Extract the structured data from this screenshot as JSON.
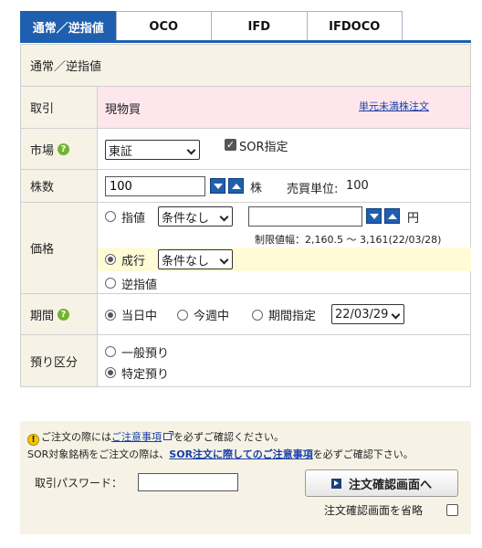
{
  "tabs": [
    {
      "label": "通常／逆指値",
      "active": true
    },
    {
      "label": "OCO",
      "active": false
    },
    {
      "label": "IFD",
      "active": false
    },
    {
      "label": "IFDOCO",
      "active": false
    }
  ],
  "section_title": "通常／逆指値",
  "trade": {
    "label": "取引",
    "value": "現物買",
    "odd_lot_link": "単元未満株注文"
  },
  "market": {
    "label": "市場",
    "help_icon": "question-circle-icon",
    "selected": "東証",
    "sor_label": "SOR指定",
    "sor_checked": true
  },
  "quantity": {
    "label": "株数",
    "value": "100",
    "unit": "株",
    "lot_label": "売買単位:",
    "lot_value": "100"
  },
  "price": {
    "label": "価格",
    "limit_label": "指値",
    "limit_condition": "条件なし",
    "limit_value": "",
    "yen": "円",
    "range_text": "制限値幅：2,160.5 ～ 3,161(22/03/28)",
    "market_label": "成行",
    "market_condition": "条件なし",
    "stop_label": "逆指値",
    "selected": "market"
  },
  "period": {
    "label": "期間",
    "help_icon": "question-circle-icon",
    "today": "当日中",
    "this_week": "今週中",
    "specify": "期間指定",
    "date": "22/03/29",
    "selected": "today"
  },
  "custody": {
    "label": "預り区分",
    "general": "一般預り",
    "specific": "特定預り",
    "selected": "specific"
  },
  "notice": {
    "line1_pre": "ご注文の際には",
    "line1_link": "ご注意事項",
    "line1_post": "を必ずご確認ください。",
    "line2_pre": "SOR対象銘柄をご注文の際は、",
    "line2_link": "SOR注文に際してのご注意事項",
    "line2_post": "を必ずご確認下さい。",
    "password_label": "取引パスワード：",
    "password_value": "",
    "confirm_button": "注文確認画面へ",
    "skip_label": "注文確認画面を省略"
  },
  "colors": {
    "accent": "#1f5fb0",
    "label_bg": "#f6f3e6",
    "trade_bg": "#fde6ec",
    "market_row_bg": "#fffbd6",
    "link": "#1a3fa8"
  }
}
